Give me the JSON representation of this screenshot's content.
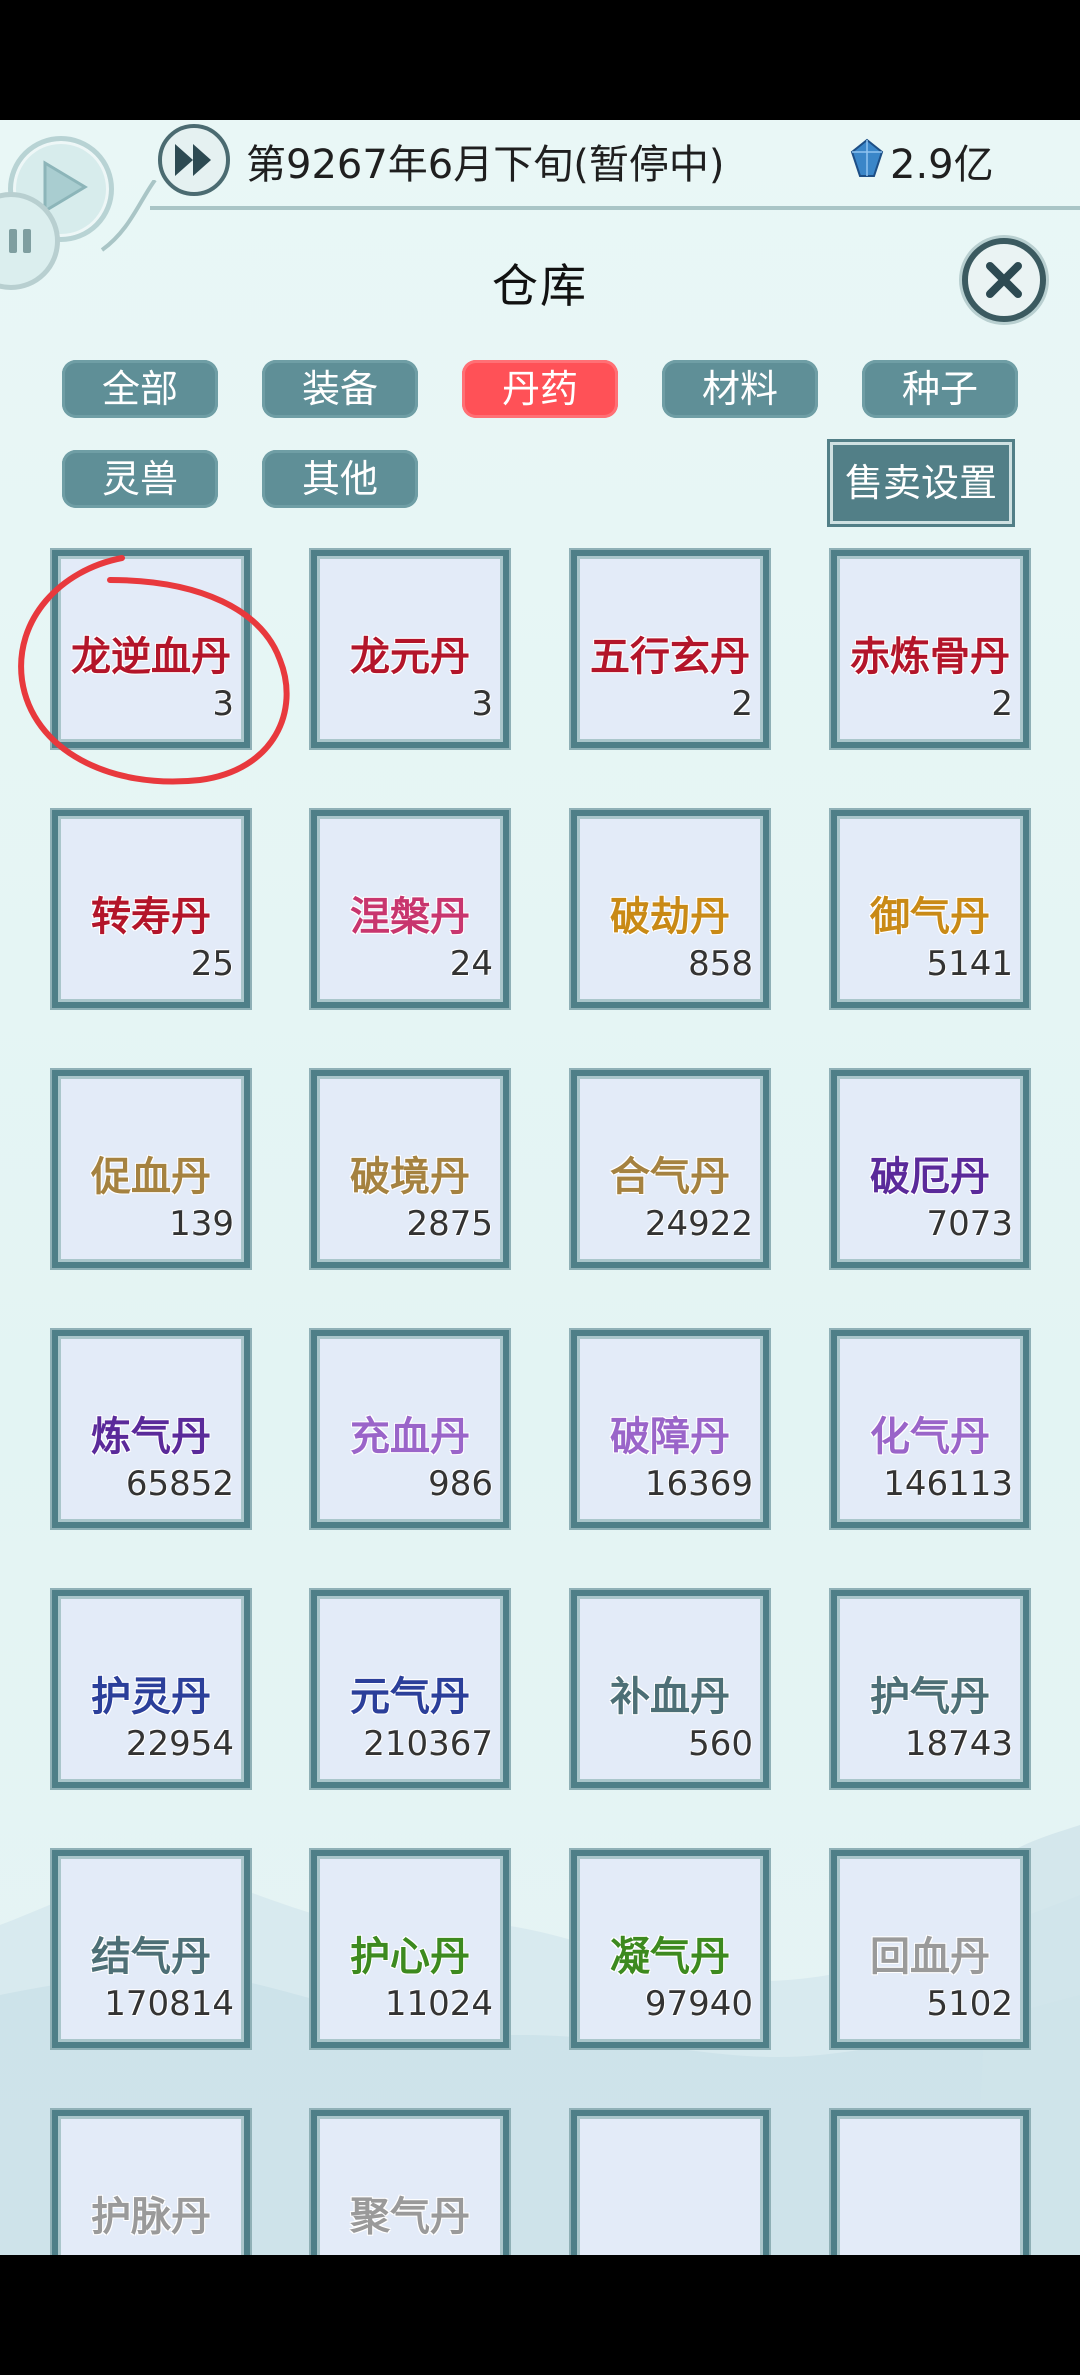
{
  "header": {
    "date_text": "第9267年6月下旬(暂停中)",
    "currency_text": "2.9亿"
  },
  "title": "仓库",
  "tabs": [
    {
      "label": "全部"
    },
    {
      "label": "装备"
    },
    {
      "label": "丹药",
      "active": true
    },
    {
      "label": "材料"
    },
    {
      "label": "种子"
    },
    {
      "label": "灵兽"
    },
    {
      "label": "其他"
    }
  ],
  "sell_settings_label": "售卖设置",
  "items": [
    {
      "name": "龙逆血丹",
      "count": "3",
      "color": "#b3152a"
    },
    {
      "name": "龙元丹",
      "count": "3",
      "color": "#b3152a"
    },
    {
      "name": "五行玄丹",
      "count": "2",
      "color": "#b3152a"
    },
    {
      "name": "赤炼骨丹",
      "count": "2",
      "color": "#b3152a"
    },
    {
      "name": "转寿丹",
      "count": "25",
      "color": "#b3152a"
    },
    {
      "name": "涅槃丹",
      "count": "24",
      "color": "#c8366e"
    },
    {
      "name": "破劫丹",
      "count": "858",
      "color": "#c98a16"
    },
    {
      "name": "御气丹",
      "count": "5141",
      "color": "#c98a16"
    },
    {
      "name": "促血丹",
      "count": "139",
      "color": "#a58240"
    },
    {
      "name": "破境丹",
      "count": "2875",
      "color": "#a58240"
    },
    {
      "name": "合气丹",
      "count": "24922",
      "color": "#a58240"
    },
    {
      "name": "破厄丹",
      "count": "7073",
      "color": "#5a2a9a"
    },
    {
      "name": "炼气丹",
      "count": "65852",
      "color": "#5a2a9a"
    },
    {
      "name": "充血丹",
      "count": "986",
      "color": "#9a65c9"
    },
    {
      "name": "破障丹",
      "count": "16369",
      "color": "#9a65c9"
    },
    {
      "name": "化气丹",
      "count": "146113",
      "color": "#9a65c9"
    },
    {
      "name": "护灵丹",
      "count": "22954",
      "color": "#2b3f9a"
    },
    {
      "name": "元气丹",
      "count": "210367",
      "color": "#2b3f9a"
    },
    {
      "name": "补血丹",
      "count": "560",
      "color": "#4d6f76"
    },
    {
      "name": "护气丹",
      "count": "18743",
      "color": "#4d6f76"
    },
    {
      "name": "结气丹",
      "count": "170814",
      "color": "#4d6f76"
    },
    {
      "name": "护心丹",
      "count": "11024",
      "color": "#3d8a1f"
    },
    {
      "name": "凝气丹",
      "count": "97940",
      "color": "#3d8a1f"
    },
    {
      "name": "回血丹",
      "count": "5102",
      "color": "#9a9a9a"
    },
    {
      "name": "护脉丹",
      "count": "",
      "color": "#9a9a9a"
    },
    {
      "name": "聚气丹",
      "count": "",
      "color": "#9a9a9a"
    },
    {
      "name": "",
      "count": "",
      "color": "#9a9a9a"
    },
    {
      "name": "",
      "count": "",
      "color": "#9a9a9a"
    }
  ],
  "icons": {
    "play": "play-icon",
    "pause": "pause-icon",
    "fast_forward": "fast-forward-icon",
    "gem": "spirit-stone-icon",
    "close": "close-icon"
  },
  "colors": {
    "tab_default": "#5f8f97",
    "tab_active": "#ff5157",
    "cell_border": "#4f7f88"
  }
}
